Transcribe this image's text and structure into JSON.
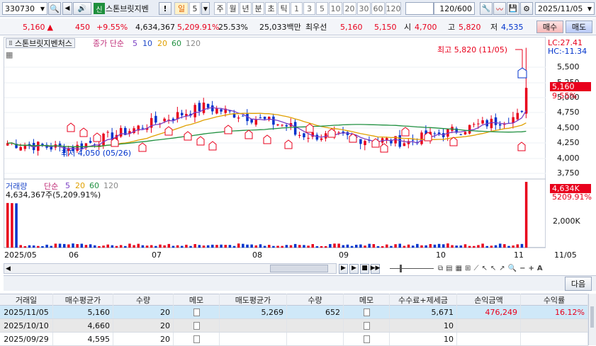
{
  "toolbar": {
    "code": "330730",
    "badge": "신",
    "name": "스톤브릿지벤",
    "warn": "!",
    "period_active": "일",
    "period_count": "5",
    "timeframes": [
      "주",
      "월",
      "년",
      "분",
      "초",
      "틱",
      "1",
      "3",
      "5",
      "10",
      "20",
      "30",
      "60",
      "120"
    ],
    "count": "120/600",
    "date": "2025/11/05"
  },
  "quote": {
    "price": "5,160",
    "change": "450",
    "change_rate": "+9.55%",
    "volume": "4,634,367",
    "volume_rate": "5,209.91%",
    "turnover_rate": "25.53%",
    "amount": "25,033백만",
    "priority_label": "최우선",
    "ask": "5,160",
    "bid": "5,150",
    "open_label": "시",
    "open": "4,700",
    "high_label": "고",
    "high": "5,820",
    "low_label": "저",
    "low": "4,535",
    "buy_label": "매수",
    "sell_label": "매도"
  },
  "legend": {
    "name": "스톤브릿지벤처스",
    "price_label": "종가 단순",
    "ma": [
      "5",
      "10",
      "20",
      "60",
      "120"
    ],
    "max_note": "최고 5,820 (11/05)",
    "min_note": "최저 4,050 (05/26)",
    "lc": "LC:27.41",
    "hc": "HC:-11.34",
    "current_price": "5,160",
    "current_rate": "9.55%"
  },
  "volume_legend": {
    "label": "거래량",
    "simple": "단순",
    "ma": [
      "5",
      "20",
      "60",
      "120"
    ],
    "current": "4,634,367주(5,209.91%)",
    "badge": "4,634K",
    "badge_rate": "5209.91%",
    "axis_tick": "2,000K"
  },
  "price_axis": [
    "5,500",
    "5,250",
    "5,000",
    "4,750",
    "4,500",
    "4,250",
    "4,000",
    "3,750"
  ],
  "date_axis": [
    "2025/05",
    "06",
    "07",
    "08",
    "09",
    "10",
    "11",
    "11/05"
  ],
  "next_label": "다음",
  "table": {
    "headers": [
      "거래일",
      "매수평균가",
      "수량",
      "메모",
      "매도평균가",
      "수량",
      "메모",
      "수수료+제세금",
      "손익금액",
      "수익률"
    ],
    "rows": [
      [
        "2025/11/05",
        "5,160",
        "20",
        "",
        "5,269",
        "652",
        "",
        "5,671",
        "476,249",
        "16.12%"
      ],
      [
        "2025/10/10",
        "4,660",
        "20",
        "",
        "",
        "",
        "",
        "10",
        "",
        ""
      ],
      [
        "2025/09/29",
        "4,595",
        "20",
        "",
        "",
        "",
        "",
        "10",
        "",
        ""
      ]
    ]
  },
  "colors": {
    "up": "#e8001c",
    "down": "#0033cc",
    "ma5": "#7b3fc4",
    "ma10": "#1f49c9",
    "ma20": "#e0a000",
    "ma60": "#209040"
  }
}
